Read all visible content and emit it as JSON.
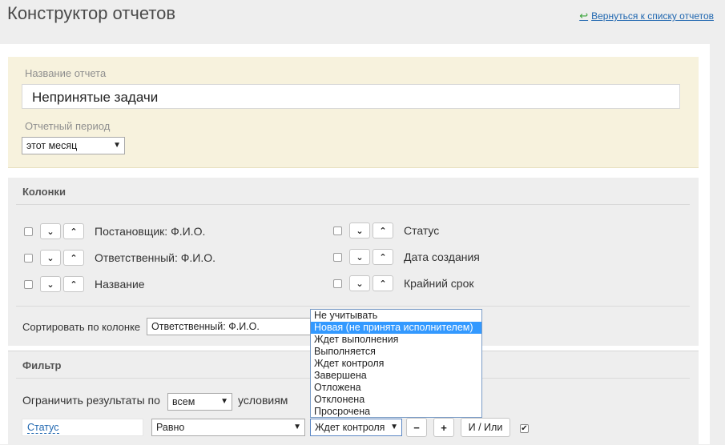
{
  "header": {
    "title": "Конструктор отчетов",
    "back_link": "Вернуться к списку отчетов",
    "back_icon": "arrow-back-icon"
  },
  "report": {
    "name_label": "Название отчета",
    "name_value": "Непринятые задачи",
    "period_label": "Отчетный период",
    "period_value": "этот месяц"
  },
  "columns": {
    "title": "Колонки",
    "left": [
      {
        "label": "Постановщик: Ф.И.О."
      },
      {
        "label": "Ответственный: Ф.И.О."
      },
      {
        "label": "Название"
      }
    ],
    "right": [
      {
        "label": "Статус"
      },
      {
        "label": "Дата создания"
      },
      {
        "label": "Крайний срок"
      }
    ],
    "down_glyph": "⌄",
    "up_glyph": "⌃"
  },
  "sort": {
    "label": "Сортировать по колонке",
    "value": "Ответственный: Ф.И.О."
  },
  "filter": {
    "title": "Фильтр",
    "limit_prefix": "Ограничить результаты по",
    "limit_value": "всем",
    "limit_suffix": "условиям",
    "field": "Статус",
    "operator": "Равно",
    "value": "Ждет контроля",
    "minus": "−",
    "plus": "+",
    "and_or": "И / Или",
    "check_mark": "✔"
  },
  "status_dropdown": {
    "options": [
      "Не учитывать",
      "Новая (не принята исполнителем)",
      "Ждет выполнения",
      "Выполняется",
      "Ждет контроля",
      "Завершена",
      "Отложена",
      "Отклонена",
      "Просрочена"
    ],
    "selected_index": 1
  },
  "colors": {
    "accent": "#3399ff",
    "link": "#2067b0",
    "name_panel_bg": "#f7f2dd"
  }
}
